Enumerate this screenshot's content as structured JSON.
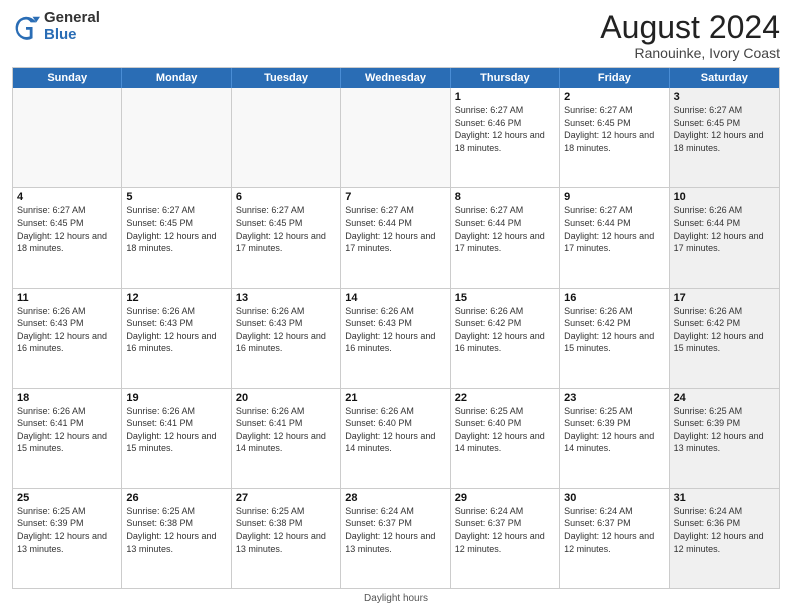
{
  "logo": {
    "general": "General",
    "blue": "Blue"
  },
  "title": "August 2024",
  "subtitle": "Ranouinke, Ivory Coast",
  "days": [
    "Sunday",
    "Monday",
    "Tuesday",
    "Wednesday",
    "Thursday",
    "Friday",
    "Saturday"
  ],
  "footer": "Daylight hours",
  "weeks": [
    [
      {
        "day": "",
        "info": "",
        "empty": true
      },
      {
        "day": "",
        "info": "",
        "empty": true
      },
      {
        "day": "",
        "info": "",
        "empty": true
      },
      {
        "day": "",
        "info": "",
        "empty": true
      },
      {
        "day": "1",
        "info": "Sunrise: 6:27 AM\nSunset: 6:46 PM\nDaylight: 12 hours\nand 18 minutes."
      },
      {
        "day": "2",
        "info": "Sunrise: 6:27 AM\nSunset: 6:45 PM\nDaylight: 12 hours\nand 18 minutes."
      },
      {
        "day": "3",
        "info": "Sunrise: 6:27 AM\nSunset: 6:45 PM\nDaylight: 12 hours\nand 18 minutes.",
        "shaded": true
      }
    ],
    [
      {
        "day": "4",
        "info": "Sunrise: 6:27 AM\nSunset: 6:45 PM\nDaylight: 12 hours\nand 18 minutes."
      },
      {
        "day": "5",
        "info": "Sunrise: 6:27 AM\nSunset: 6:45 PM\nDaylight: 12 hours\nand 18 minutes."
      },
      {
        "day": "6",
        "info": "Sunrise: 6:27 AM\nSunset: 6:45 PM\nDaylight: 12 hours\nand 17 minutes."
      },
      {
        "day": "7",
        "info": "Sunrise: 6:27 AM\nSunset: 6:44 PM\nDaylight: 12 hours\nand 17 minutes."
      },
      {
        "day": "8",
        "info": "Sunrise: 6:27 AM\nSunset: 6:44 PM\nDaylight: 12 hours\nand 17 minutes."
      },
      {
        "day": "9",
        "info": "Sunrise: 6:27 AM\nSunset: 6:44 PM\nDaylight: 12 hours\nand 17 minutes."
      },
      {
        "day": "10",
        "info": "Sunrise: 6:26 AM\nSunset: 6:44 PM\nDaylight: 12 hours\nand 17 minutes.",
        "shaded": true
      }
    ],
    [
      {
        "day": "11",
        "info": "Sunrise: 6:26 AM\nSunset: 6:43 PM\nDaylight: 12 hours\nand 16 minutes."
      },
      {
        "day": "12",
        "info": "Sunrise: 6:26 AM\nSunset: 6:43 PM\nDaylight: 12 hours\nand 16 minutes."
      },
      {
        "day": "13",
        "info": "Sunrise: 6:26 AM\nSunset: 6:43 PM\nDaylight: 12 hours\nand 16 minutes."
      },
      {
        "day": "14",
        "info": "Sunrise: 6:26 AM\nSunset: 6:43 PM\nDaylight: 12 hours\nand 16 minutes."
      },
      {
        "day": "15",
        "info": "Sunrise: 6:26 AM\nSunset: 6:42 PM\nDaylight: 12 hours\nand 16 minutes."
      },
      {
        "day": "16",
        "info": "Sunrise: 6:26 AM\nSunset: 6:42 PM\nDaylight: 12 hours\nand 15 minutes."
      },
      {
        "day": "17",
        "info": "Sunrise: 6:26 AM\nSunset: 6:42 PM\nDaylight: 12 hours\nand 15 minutes.",
        "shaded": true
      }
    ],
    [
      {
        "day": "18",
        "info": "Sunrise: 6:26 AM\nSunset: 6:41 PM\nDaylight: 12 hours\nand 15 minutes."
      },
      {
        "day": "19",
        "info": "Sunrise: 6:26 AM\nSunset: 6:41 PM\nDaylight: 12 hours\nand 15 minutes."
      },
      {
        "day": "20",
        "info": "Sunrise: 6:26 AM\nSunset: 6:41 PM\nDaylight: 12 hours\nand 14 minutes."
      },
      {
        "day": "21",
        "info": "Sunrise: 6:26 AM\nSunset: 6:40 PM\nDaylight: 12 hours\nand 14 minutes."
      },
      {
        "day": "22",
        "info": "Sunrise: 6:25 AM\nSunset: 6:40 PM\nDaylight: 12 hours\nand 14 minutes."
      },
      {
        "day": "23",
        "info": "Sunrise: 6:25 AM\nSunset: 6:39 PM\nDaylight: 12 hours\nand 14 minutes."
      },
      {
        "day": "24",
        "info": "Sunrise: 6:25 AM\nSunset: 6:39 PM\nDaylight: 12 hours\nand 13 minutes.",
        "shaded": true
      }
    ],
    [
      {
        "day": "25",
        "info": "Sunrise: 6:25 AM\nSunset: 6:39 PM\nDaylight: 12 hours\nand 13 minutes."
      },
      {
        "day": "26",
        "info": "Sunrise: 6:25 AM\nSunset: 6:38 PM\nDaylight: 12 hours\nand 13 minutes."
      },
      {
        "day": "27",
        "info": "Sunrise: 6:25 AM\nSunset: 6:38 PM\nDaylight: 12 hours\nand 13 minutes."
      },
      {
        "day": "28",
        "info": "Sunrise: 6:24 AM\nSunset: 6:37 PM\nDaylight: 12 hours\nand 13 minutes."
      },
      {
        "day": "29",
        "info": "Sunrise: 6:24 AM\nSunset: 6:37 PM\nDaylight: 12 hours\nand 12 minutes."
      },
      {
        "day": "30",
        "info": "Sunrise: 6:24 AM\nSunset: 6:37 PM\nDaylight: 12 hours\nand 12 minutes."
      },
      {
        "day": "31",
        "info": "Sunrise: 6:24 AM\nSunset: 6:36 PM\nDaylight: 12 hours\nand 12 minutes.",
        "shaded": true
      }
    ]
  ]
}
